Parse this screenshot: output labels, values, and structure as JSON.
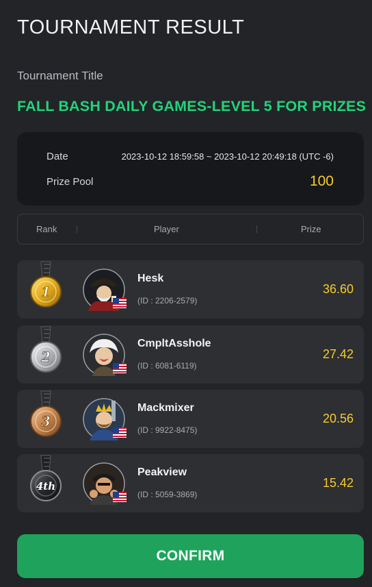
{
  "header": {
    "title": "TOURNAMENT RESULT"
  },
  "tournament": {
    "title_label": "Tournament Title",
    "name": "FALL BASH DAILY GAMES-LEVEL 5 FOR PRIZES"
  },
  "info": {
    "date_label": "Date",
    "date_value": "2023-10-12 18:59:58 ~ 2023-10-12 20:49:18 (UTC -6)",
    "prize_pool_label": "Prize Pool",
    "prize_pool_value": "100"
  },
  "table": {
    "columns": {
      "rank": "Rank",
      "player": "Player",
      "prize": "Prize"
    },
    "rows": [
      {
        "rank": "1",
        "medal": "gold-medal-icon",
        "name": "Hesk",
        "id": "(ID : 2206-2579)",
        "prize": "36.60",
        "flag": "us-flag-icon",
        "avatar": "pirate-captain-avatar"
      },
      {
        "rank": "2",
        "medal": "silver-medal-icon",
        "name": "CmpltAsshole",
        "id": "(ID : 6081-6119)",
        "prize": "27.42",
        "flag": "us-flag-icon",
        "avatar": "einstein-avatar"
      },
      {
        "rank": "3",
        "medal": "bronze-medal-icon",
        "name": "Mackmixer",
        "id": "(ID : 9922-8475)",
        "prize": "20.56",
        "flag": "us-flag-icon",
        "avatar": "king-avatar"
      },
      {
        "rank": "4th",
        "medal": "black-medal-icon",
        "name": "Peakview",
        "id": "(ID : 5059-3869)",
        "prize": "15.42",
        "flag": "us-flag-icon",
        "avatar": "thug-avatar"
      }
    ]
  },
  "footer": {
    "confirm_label": "CONFIRM"
  },
  "colors": {
    "accent_green": "#22d37a",
    "button_green": "#1fa35c",
    "prize_yellow": "#f6cc2c",
    "background": "#222427"
  }
}
